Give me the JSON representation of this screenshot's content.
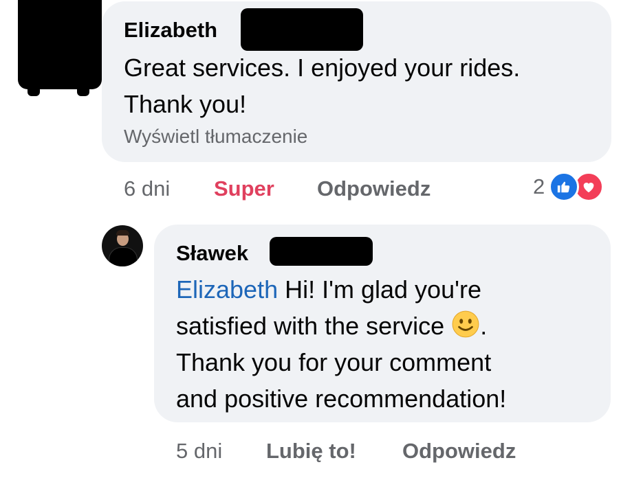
{
  "comment": {
    "author": "Elizabeth",
    "text_line1": "Great services. I enjoyed your rides.",
    "text_line2": "Thank you!",
    "translate_label": "Wyświetl tłumaczenie",
    "time": "6 dni",
    "reaction_label": "Super",
    "reply_label": "Odpowiedz",
    "reaction_count": "2",
    "reaction_icons": [
      "like-icon",
      "love-icon"
    ],
    "colors": {
      "reaction_label": "#e0405e",
      "like": "#1b74e4",
      "love": "#f33e58"
    }
  },
  "reply": {
    "author": "Sławek",
    "mention": "Elizabeth",
    "text_part1": " Hi! I'm glad you're",
    "text_line2": "satisfied with the service",
    "emoji": "slightly-smiling-face",
    "text_line2_end": ".",
    "text_line3": "Thank you for your comment",
    "text_line4": "and positive recommendation!",
    "time": "5 dni",
    "like_label": "Lubię to!",
    "reply_label": "Odpowiedz",
    "colors": {
      "mention": "#1d66b8"
    }
  }
}
